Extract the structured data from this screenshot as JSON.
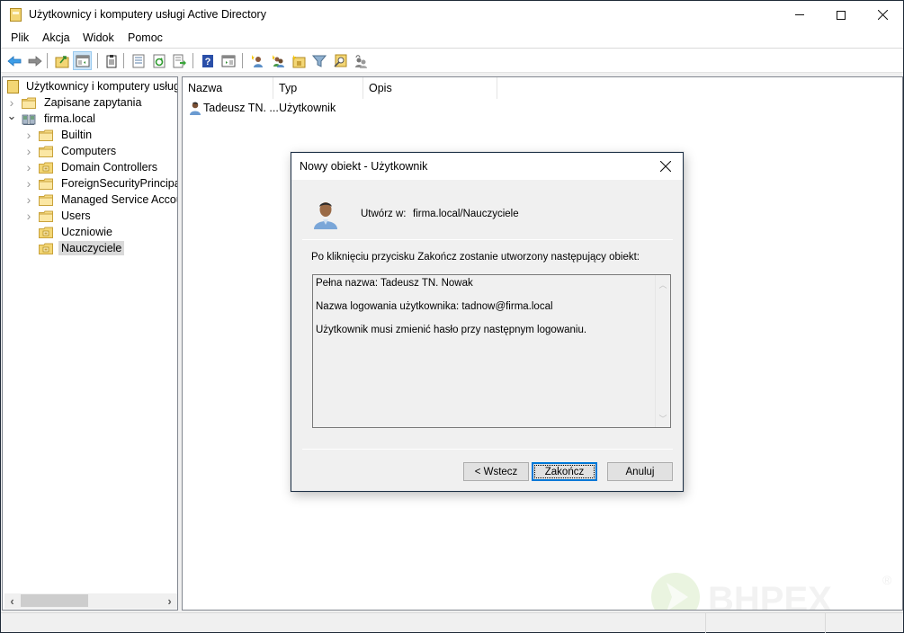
{
  "window": {
    "title": "Użytkownicy i komputery usługi Active Directory",
    "controls": {
      "minimize": "minimize",
      "maximize": "maximize",
      "close": "close"
    }
  },
  "menu": {
    "items": [
      {
        "label": "Plik"
      },
      {
        "label": "Akcja"
      },
      {
        "label": "Widok"
      },
      {
        "label": "Pomoc"
      }
    ]
  },
  "toolbar": {
    "buttons": [
      {
        "icon": "back-arrow-icon"
      },
      {
        "icon": "forward-arrow-icon"
      },
      {
        "icon": "up-folder-icon"
      },
      {
        "icon": "show-hide-console-tree-icon",
        "active": true
      },
      {
        "icon": "clipboard-icon"
      },
      {
        "icon": "properties-icon"
      },
      {
        "icon": "refresh-icon"
      },
      {
        "icon": "export-list-icon"
      },
      {
        "icon": "help-icon"
      },
      {
        "icon": "show-action-pane-icon"
      },
      {
        "icon": "new-user-icon"
      },
      {
        "icon": "new-group-icon"
      },
      {
        "icon": "new-ou-icon"
      },
      {
        "icon": "filter-icon"
      },
      {
        "icon": "find-icon"
      },
      {
        "icon": "add-to-group-icon"
      }
    ]
  },
  "tree": {
    "root": "Użytkownicy i komputery usługi Active Directory",
    "items": [
      {
        "label": "Zapisane zapytania",
        "level": 1,
        "expander": "collapsed",
        "icon": "folder"
      },
      {
        "label": "firma.local",
        "level": 1,
        "expander": "expanded",
        "icon": "domain"
      },
      {
        "label": "Builtin",
        "level": 2,
        "expander": "collapsed",
        "icon": "folder"
      },
      {
        "label": "Computers",
        "level": 2,
        "expander": "collapsed",
        "icon": "folder"
      },
      {
        "label": "Domain Controllers",
        "level": 2,
        "expander": "collapsed",
        "icon": "ou"
      },
      {
        "label": "ForeignSecurityPrincipals",
        "level": 2,
        "expander": "collapsed",
        "icon": "folder"
      },
      {
        "label": "Managed Service Accounts",
        "level": 2,
        "expander": "collapsed",
        "icon": "folder"
      },
      {
        "label": "Users",
        "level": 2,
        "expander": "collapsed",
        "icon": "folder"
      },
      {
        "label": "Uczniowie",
        "level": 2,
        "expander": "none",
        "icon": "ou"
      },
      {
        "label": "Nauczyciele",
        "level": 2,
        "expander": "none",
        "icon": "ou",
        "selected": true
      }
    ]
  },
  "list": {
    "columns": [
      "Nazwa",
      "Typ",
      "Opis"
    ],
    "rows": [
      {
        "name": "Tadeusz TN. ...",
        "type": "Użytkownik",
        "description": ""
      }
    ]
  },
  "dialog": {
    "title": "Nowy obiekt - Użytkownik",
    "create_in_label": "Utwórz w:",
    "create_in_path": "firma.local/Nauczyciele",
    "intro": "Po kliknięciu przycisku Zakończ zostanie utworzony następujący obiekt:",
    "summary": [
      "Pełna nazwa: Tadeusz TN. Nowak",
      "Nazwa logowania użytkownika: tadnow@firma.local",
      "Użytkownik musi zmienić hasło przy następnym logowaniu."
    ],
    "buttons": {
      "back": "< Wstecz",
      "finish": "Zakończ",
      "cancel": "Anuluj"
    }
  },
  "watermark": {
    "text": "BHPEX",
    "mark": "®"
  },
  "colors": {
    "accent": "#0078d7",
    "selection": "#d9d9d9",
    "folder": "#f3d675"
  }
}
